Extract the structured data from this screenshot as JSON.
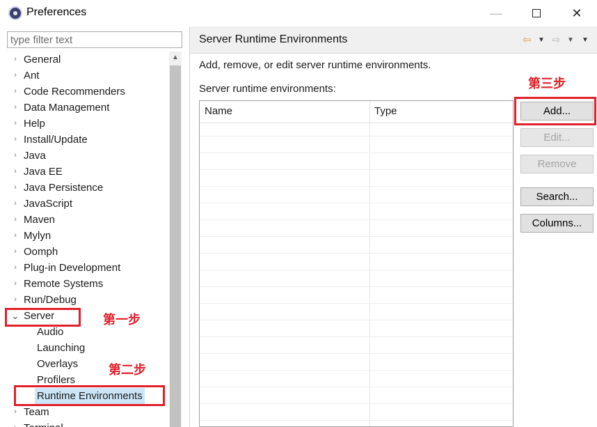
{
  "window": {
    "title": "Preferences",
    "minimize_glyph": "—",
    "close_glyph": "✕"
  },
  "filter": {
    "placeholder": "type filter text",
    "value": ""
  },
  "tree": {
    "scroll_up_glyph": "▲",
    "items": [
      {
        "label": "General",
        "chevron": "›"
      },
      {
        "label": "Ant",
        "chevron": "›"
      },
      {
        "label": "Code Recommenders",
        "chevron": "›"
      },
      {
        "label": "Data Management",
        "chevron": "›"
      },
      {
        "label": "Help",
        "chevron": "›"
      },
      {
        "label": "Install/Update",
        "chevron": "›"
      },
      {
        "label": "Java",
        "chevron": "›"
      },
      {
        "label": "Java EE",
        "chevron": "›"
      },
      {
        "label": "Java Persistence",
        "chevron": "›"
      },
      {
        "label": "JavaScript",
        "chevron": "›"
      },
      {
        "label": "Maven",
        "chevron": "›"
      },
      {
        "label": "Mylyn",
        "chevron": "›"
      },
      {
        "label": "Oomph",
        "chevron": "›"
      },
      {
        "label": "Plug-in Development",
        "chevron": "›"
      },
      {
        "label": "Remote Systems",
        "chevron": "›"
      },
      {
        "label": "Run/Debug",
        "chevron": "›"
      },
      {
        "label": "Server",
        "chevron": "⌄"
      },
      {
        "label": "Audio"
      },
      {
        "label": "Launching"
      },
      {
        "label": "Overlays"
      },
      {
        "label": "Profilers"
      },
      {
        "label": "Runtime Environments"
      },
      {
        "label": "Team",
        "chevron": "›"
      },
      {
        "label": "Terminal",
        "chevron": "›"
      }
    ]
  },
  "panel": {
    "title": "Server Runtime Environments",
    "nav": {
      "back": "⇦",
      "dropdown": "▼",
      "forward": "⇨"
    },
    "description": "Add, remove, or edit server runtime environments.",
    "list_label": "Server runtime environments:",
    "table": {
      "columns": [
        "Name",
        "Type"
      ],
      "rows": []
    },
    "buttons": {
      "add": "Add...",
      "edit": "Edit...",
      "remove": "Remove",
      "search": "Search...",
      "columns": "Columns..."
    }
  },
  "annotations": {
    "step1": "第一步",
    "step2": "第二步",
    "step3": "第三步",
    "color": "#e0202a"
  }
}
